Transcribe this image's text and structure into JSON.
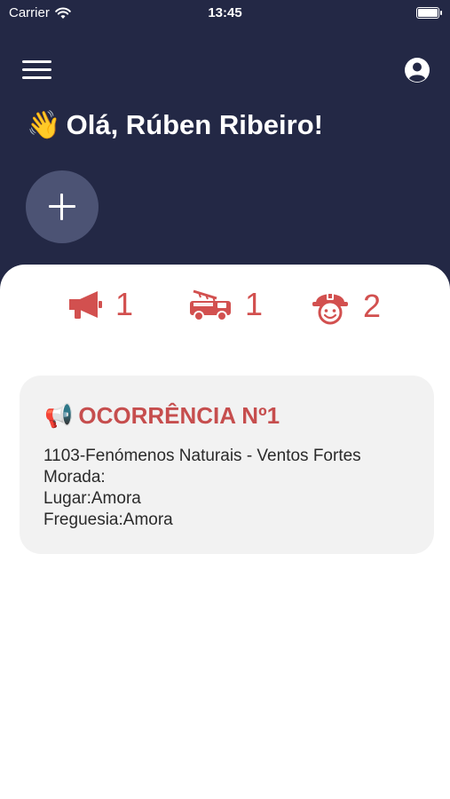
{
  "status_bar": {
    "carrier": "Carrier",
    "time": "13:45"
  },
  "header": {
    "greeting_emoji": "👋",
    "greeting": "Olá, Rúben Ribeiro!",
    "menu_icon": "hamburger-menu-icon",
    "profile_icon": "user-circle-icon",
    "add_icon": "plus-icon"
  },
  "stats": [
    {
      "icon": "megaphone-icon",
      "value": "1"
    },
    {
      "icon": "fire-truck-icon",
      "value": "1"
    },
    {
      "icon": "firefighter-icon",
      "value": "2"
    }
  ],
  "occurrences": [
    {
      "icon": "📢",
      "title": "OCORRÊNCIA Nº1",
      "type": "1103-Fenómenos Naturais - Ventos Fortes",
      "address": "Morada:",
      "place": "Lugar:Amora",
      "parish": "Freguesia:Amora"
    }
  ],
  "colors": {
    "header_bg": "#232845",
    "accent_red": "#d2504f",
    "card_bg": "#f2f2f2",
    "add_button_bg": "#4c5374"
  }
}
